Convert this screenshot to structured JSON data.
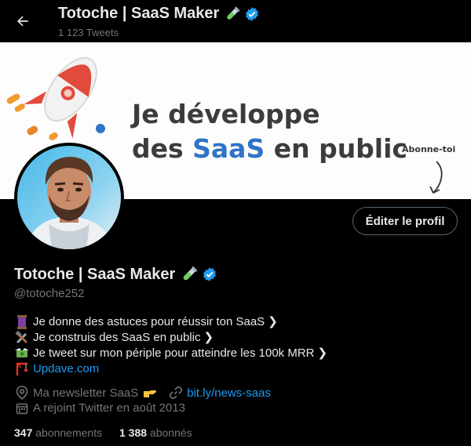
{
  "header": {
    "title": "Totoche | SaaS Maker",
    "tweet_count": "1 123 Tweets"
  },
  "banner": {
    "line1": "Je développe",
    "line2_pre": "des ",
    "line2_accent": "SaaS",
    "line2_post": " en public",
    "cta": "Abonne-toi"
  },
  "profile": {
    "edit_label": "Éditer le profil",
    "name": "Totoche | SaaS Maker",
    "handle": "@totoche252"
  },
  "bio": {
    "line1": "Je donne des astuces pour réussir ton SaaS",
    "line2": "Je construis des SaaS en public",
    "line3": "Je tweet sur mon périple pour atteindre les 100k MRR",
    "website": "Updave.com",
    "chevron": "❯"
  },
  "meta": {
    "location": "Ma newsletter SaaS",
    "url": "bit.ly/news-saas",
    "joined": "A rejoint Twitter en août 2013"
  },
  "stats": {
    "following_count": "347",
    "following_label": "abonnements",
    "followers_count": "1 388",
    "followers_label": "abonnés"
  },
  "colors": {
    "accent": "#1d9bf0",
    "background": "#000000",
    "text": "#e7e9ea",
    "muted": "#71767b",
    "banner_accent": "#2f74c6"
  },
  "icons": {
    "back": "arrow-left-icon",
    "verified": "verified-badge-icon",
    "test_tube": "test-tube-emoji-icon",
    "spool": "thread-spool-emoji-icon",
    "tools": "hammer-wrench-emoji-icon",
    "money": "money-wings-emoji-icon",
    "crane": "crane-emoji-icon",
    "location": "location-pin-icon",
    "pointing": "pointing-right-emoji-icon",
    "link": "link-icon",
    "calendar": "calendar-icon"
  }
}
